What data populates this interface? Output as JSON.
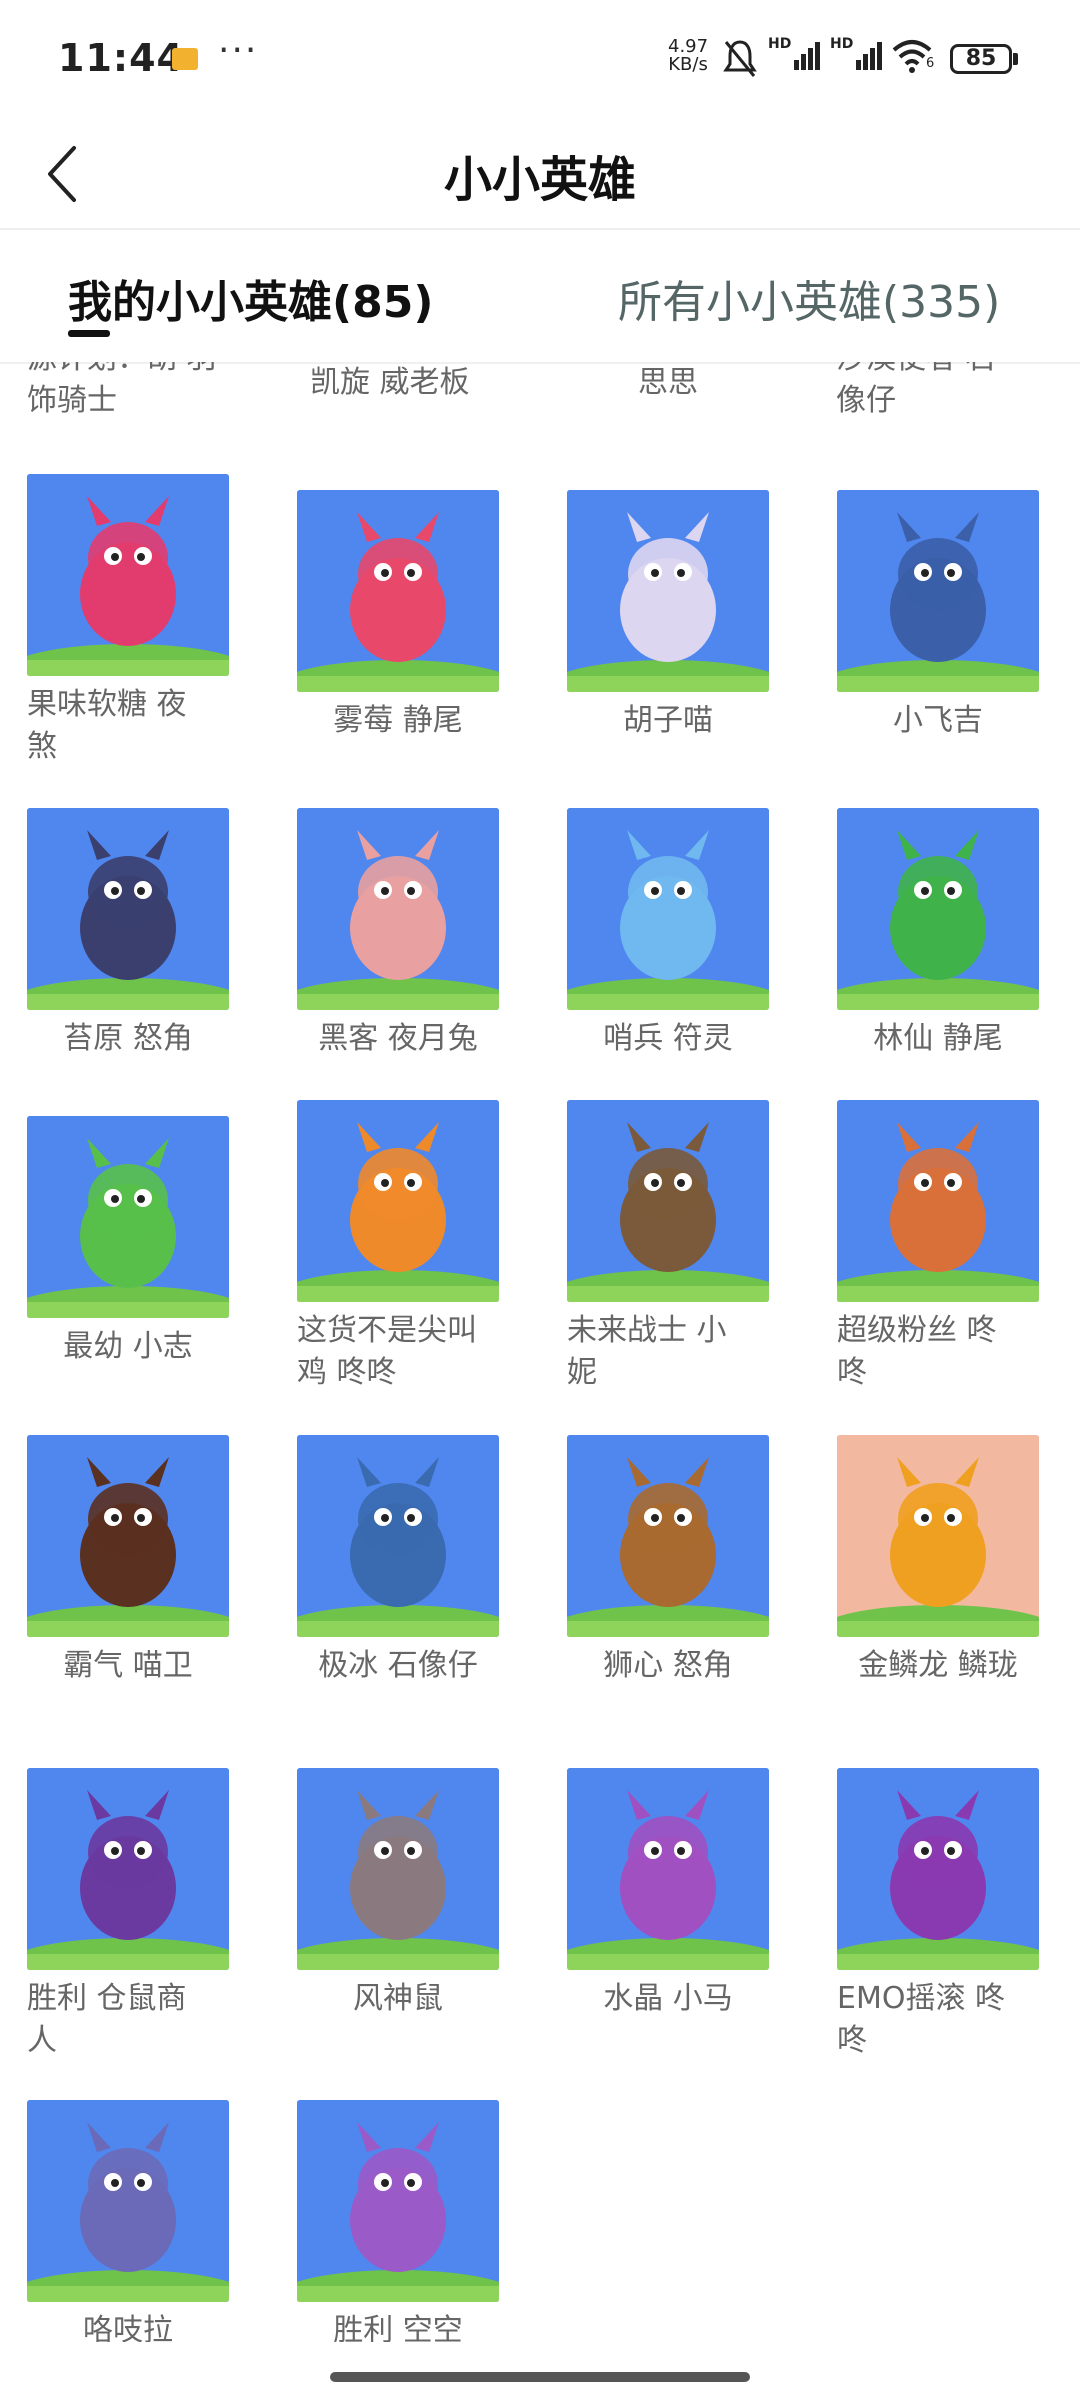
{
  "status_bar": {
    "time": "11:44",
    "more": "···",
    "net_speed_value": "4.97",
    "net_speed_unit": "KB/s",
    "battery": "85",
    "hd1": "HD",
    "hd2": "HD",
    "wifi_badge": "6",
    "icons": [
      "message-icon",
      "mute-icon",
      "signal-icon",
      "signal-icon",
      "wifi-icon",
      "battery-icon"
    ]
  },
  "header": {
    "title": "小小英雄"
  },
  "tabs": [
    {
      "label": "我的小小英雄(85)",
      "active": true
    },
    {
      "label": "所有小小英雄(335)",
      "active": false
    }
  ],
  "partial_row": [
    {
      "name": "源计划：胡 羽\n饰骑士"
    },
    {
      "name": "凯旋 威老板"
    },
    {
      "name": "思思"
    },
    {
      "name": "沙漠使者 石\n像仔"
    }
  ],
  "heroes": [
    {
      "name": "果味软糖 夜\n煞",
      "bg": "#4f87ef",
      "color": "#e23c6f"
    },
    {
      "name": "雾莓 静尾",
      "bg": "#4f87ef",
      "color": "#e8486a"
    },
    {
      "name": "胡子喵",
      "bg": "#4f87ef",
      "color": "#ddd6f0"
    },
    {
      "name": "小飞吉",
      "bg": "#4f87ef",
      "color": "#3b5fa8"
    },
    {
      "name": "苔原 怒角",
      "bg": "#4f87ef",
      "color": "#3a3f6e"
    },
    {
      "name": "黑客  夜月兔",
      "bg": "#4f87ef",
      "color": "#e8a0a0"
    },
    {
      "name": "哨兵 符灵",
      "bg": "#4f87ef",
      "color": "#6fb8f0"
    },
    {
      "name": "林仙 静尾",
      "bg": "#4f87ef",
      "color": "#3fb34a"
    },
    {
      "name": "最幼 小志",
      "bg": "#4f87ef",
      "color": "#58c04a"
    },
    {
      "name": "这货不是尖叫\n鸡 咚咚",
      "bg": "#4f87ef",
      "color": "#ef8a2a"
    },
    {
      "name": "未来战士 小\n妮",
      "bg": "#4f87ef",
      "color": "#7a5a3a"
    },
    {
      "name": "超级粉丝 咚\n咚",
      "bg": "#4f87ef",
      "color": "#d9703a"
    },
    {
      "name": "霸气 喵卫",
      "bg": "#4f87ef",
      "color": "#5a3020"
    },
    {
      "name": "极冰 石像仔",
      "bg": "#4f87ef",
      "color": "#3a6ab0"
    },
    {
      "name": "狮心 怒角",
      "bg": "#4f87ef",
      "color": "#a86a30"
    },
    {
      "name": "金鳞龙 鳞珑",
      "bg": "#f2b8a0",
      "color": "#f0a020"
    },
    {
      "name": "胜利 仓鼠商\n人",
      "bg": "#4f87ef",
      "color": "#6a3aa0"
    },
    {
      "name": "风神鼠",
      "bg": "#4f87ef",
      "color": "#8a7a80"
    },
    {
      "name": "水晶 小马",
      "bg": "#4f87ef",
      "color": "#a050c0"
    },
    {
      "name": "EMO摇滚 咚\n咚",
      "bg": "#4f87ef",
      "color": "#8a3ab0"
    },
    {
      "name": "咯吱拉",
      "bg": "#4f87ef",
      "color": "#6a6ab8"
    },
    {
      "name": "胜利 空空",
      "bg": "#4f87ef",
      "color": "#9a5ac8"
    }
  ]
}
